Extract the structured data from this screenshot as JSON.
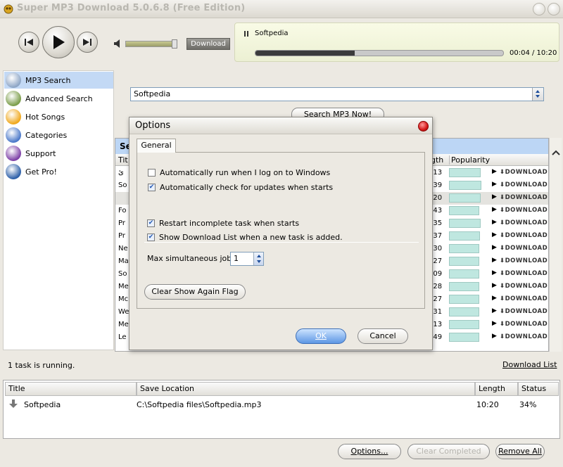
{
  "window": {
    "title": "Super MP3 Download  5.0.6.8  (Free Edition)"
  },
  "player": {
    "download_label": "Download",
    "track": "Softpedia",
    "time": "00:04 / 10:20",
    "progress": 0.4,
    "volume": 0.9
  },
  "sidebar": {
    "items": [
      {
        "label": "MP3 Search",
        "icon": "music-search-icon"
      },
      {
        "label": "Advanced Search",
        "icon": "magnifier-icon"
      },
      {
        "label": "Hot Songs",
        "icon": "sun-icon"
      },
      {
        "label": "Categories",
        "icon": "categories-icon"
      },
      {
        "label": "Support",
        "icon": "question-icon"
      },
      {
        "label": "Get Pro!",
        "icon": "globe-icon"
      }
    ]
  },
  "search": {
    "value": "Softpedia",
    "button": "Search MP3 Now!"
  },
  "results": {
    "header": "Se",
    "columns": [
      "Tit",
      "gth",
      "Popularity"
    ],
    "download_label": "DOWNLOAD",
    "rows": [
      {
        "title": "ئ",
        "length": ":13",
        "popularity": 0.9
      },
      {
        "title": "So",
        "length": ":39",
        "popularity": 0.92
      },
      {
        "title": "",
        "length": ":20",
        "popularity": 0.9
      },
      {
        "title": "Fo",
        "length": ":43",
        "popularity": 0.86
      },
      {
        "title": "Pr",
        "length": ":35",
        "popularity": 0.9
      },
      {
        "title": "Pr",
        "length": ":37",
        "popularity": 0.88
      },
      {
        "title": "Ne",
        "length": ":30",
        "popularity": 0.86
      },
      {
        "title": "Ma",
        "length": ":27",
        "popularity": 0.85
      },
      {
        "title": "So",
        "length": ":09",
        "popularity": 0.85
      },
      {
        "title": "Me",
        "length": ":28",
        "popularity": 0.86
      },
      {
        "title": "Mc",
        "length": ":27",
        "popularity": 0.86
      },
      {
        "title": "We",
        "length": ":31",
        "popularity": 0.86
      },
      {
        "title": "Me",
        "length": ":13",
        "popularity": 0.86
      },
      {
        "title": "Le",
        "length": ":49",
        "popularity": 0.86
      }
    ]
  },
  "status": {
    "text": "1 task is running.",
    "link": "Download List"
  },
  "tasks": {
    "columns": [
      "Title",
      "Save Location",
      "Length",
      "Status"
    ],
    "rows": [
      {
        "title": "Softpedia",
        "location": "C:\\Softpedia files\\Softpedia.mp3",
        "length": "10:20",
        "status": "34%"
      }
    ]
  },
  "buttons": {
    "options": "Options...",
    "clear_completed": "Clear Completed",
    "remove_all": "Remove All"
  },
  "dialog": {
    "title": "Options",
    "tab": "General",
    "opt_run_on_logon": "Automatically run when I log on to Windows",
    "opt_check_updates": "Automatically check for updates when starts",
    "opt_restart_incomplete": "Restart incomplete task when starts",
    "opt_show_download_list": "Show Download List when a new task is added.",
    "max_jobs_label": "Max simultaneous jobs",
    "max_jobs_value": "1",
    "clear_flag": "Clear Show Again Flag",
    "ok": "OK",
    "cancel": "Cancel"
  },
  "colors": {
    "selection": "#c3d9f5",
    "popularity_bar": "#bfe7e0",
    "nowplaying_bg": "#f3f6df",
    "ok_button": "#5d96e4"
  }
}
